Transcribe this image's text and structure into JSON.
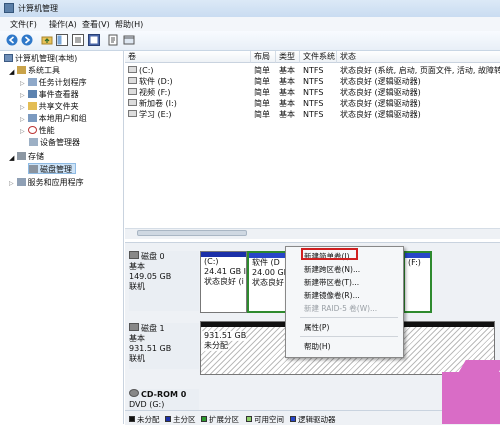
{
  "window": {
    "title": "计算机管理"
  },
  "menu": [
    "文件(F)",
    "操作(A)",
    "查看(V)",
    "帮助(H)"
  ],
  "toolbar": {
    "icons": [
      "back-icon",
      "forward-icon",
      "folder-up-icon",
      "console-tree-icon",
      "properties-icon",
      "help-icon",
      "export-icon",
      "view-icon"
    ]
  },
  "tree": {
    "root": "计算机管理(本地)",
    "system_tools": "系统工具",
    "task_scheduler": "任务计划程序",
    "event_viewer": "事件查看器",
    "shared_folders": "共享文件夹",
    "local_users": "本地用户和组",
    "performance": "性能",
    "device_manager": "设备管理器",
    "storage": "存储",
    "disk_management": "磁盘管理",
    "services": "服务和应用程序"
  },
  "list": {
    "columns": [
      "卷",
      "布局",
      "类型",
      "文件系统",
      "状态"
    ],
    "rows": [
      [
        "(C:)",
        "简单",
        "基本",
        "NTFS",
        "状态良好 (系统, 启动, 页面文件, 活动, 故障转储"
      ],
      [
        "软件 (D:)",
        "简单",
        "基本",
        "NTFS",
        "状态良好 (逻辑驱动器)"
      ],
      [
        "视频 (F:)",
        "简单",
        "基本",
        "NTFS",
        "状态良好 (逻辑驱动器)"
      ],
      [
        "新加卷 (I:)",
        "简单",
        "基本",
        "NTFS",
        "状态良好 (逻辑驱动器)"
      ],
      [
        "学习 (E:)",
        "简单",
        "基本",
        "NTFS",
        "状态良好 (逻辑驱动器)"
      ]
    ]
  },
  "disks": {
    "disk0": {
      "name": "磁盘 0",
      "type": "基本",
      "size": "149.05 GB",
      "status": "联机",
      "partitions": [
        {
          "label": "(C:)",
          "size": "24.41 GB I",
          "status": "状态良好 (i"
        },
        {
          "label": "软件 (D",
          "size": "24.00 GB",
          "status": "状态良好"
        },
        {
          "label": "(F:)",
          "size": "",
          "status": ""
        }
      ]
    },
    "disk1": {
      "name": "磁盘 1",
      "type": "基本",
      "size": "931.51 GB",
      "status": "联机",
      "unalloc_size": "931.51 GB",
      "unalloc_label": "未分配"
    },
    "cdrom": {
      "name": "CD-ROM 0",
      "line2": "DVD (G:)"
    }
  },
  "context_menu": {
    "items": [
      "新建简单卷(I)...",
      "新建跨区卷(N)...",
      "新建带区卷(T)...",
      "新建镜像卷(R)...",
      "新建 RAID-5 卷(W)...",
      "属性(P)",
      "帮助(H)"
    ],
    "disabled_index": 4
  },
  "legend": [
    {
      "label": "未分配",
      "color": "#111111"
    },
    {
      "label": "主分区",
      "color": "#1b2fa8"
    },
    {
      "label": "扩展分区",
      "color": "#2e9a2e"
    },
    {
      "label": "可用空间",
      "color": "#8fd16a"
    },
    {
      "label": "逻辑驱动器",
      "color": "#2846c8"
    }
  ]
}
